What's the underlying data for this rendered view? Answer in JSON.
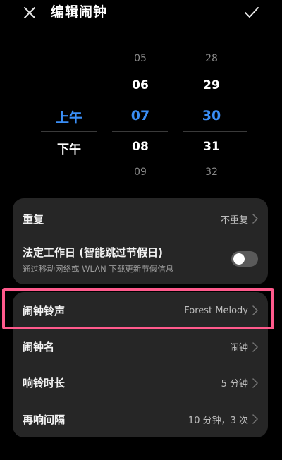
{
  "header": {
    "title": "编辑闹钟",
    "close_icon": "close-icon",
    "confirm_icon": "check-icon"
  },
  "picker": {
    "ampm": {
      "above": "",
      "selected": "上午",
      "below": "下午"
    },
    "hours": {
      "far_above": "05",
      "above": "06",
      "selected": "07",
      "below": "08",
      "far_below": "09"
    },
    "minutes": {
      "far_above": "28",
      "above": "29",
      "selected": "30",
      "below": "31",
      "far_below": "32"
    }
  },
  "settings": {
    "repeat": {
      "label": "重复",
      "value": "不重复"
    },
    "workday": {
      "label": "法定工作日 (智能跳过节假日)",
      "sub": "通过移动网络或 WLAN 下载更新节假信息",
      "enabled": false
    },
    "ringtone": {
      "label": "闹钟铃声",
      "value": "Forest Melody"
    },
    "name": {
      "label": "闹钟名",
      "value": "闹钟"
    },
    "duration": {
      "label": "响铃时长",
      "value": "5 分钟"
    },
    "snooze": {
      "label": "再响间隔",
      "value": "10 分钟，3 次"
    }
  },
  "colors": {
    "accent": "#3a8ef6",
    "highlight": "#ff5a8c",
    "card_bg": "#262626",
    "background": "#000000"
  }
}
